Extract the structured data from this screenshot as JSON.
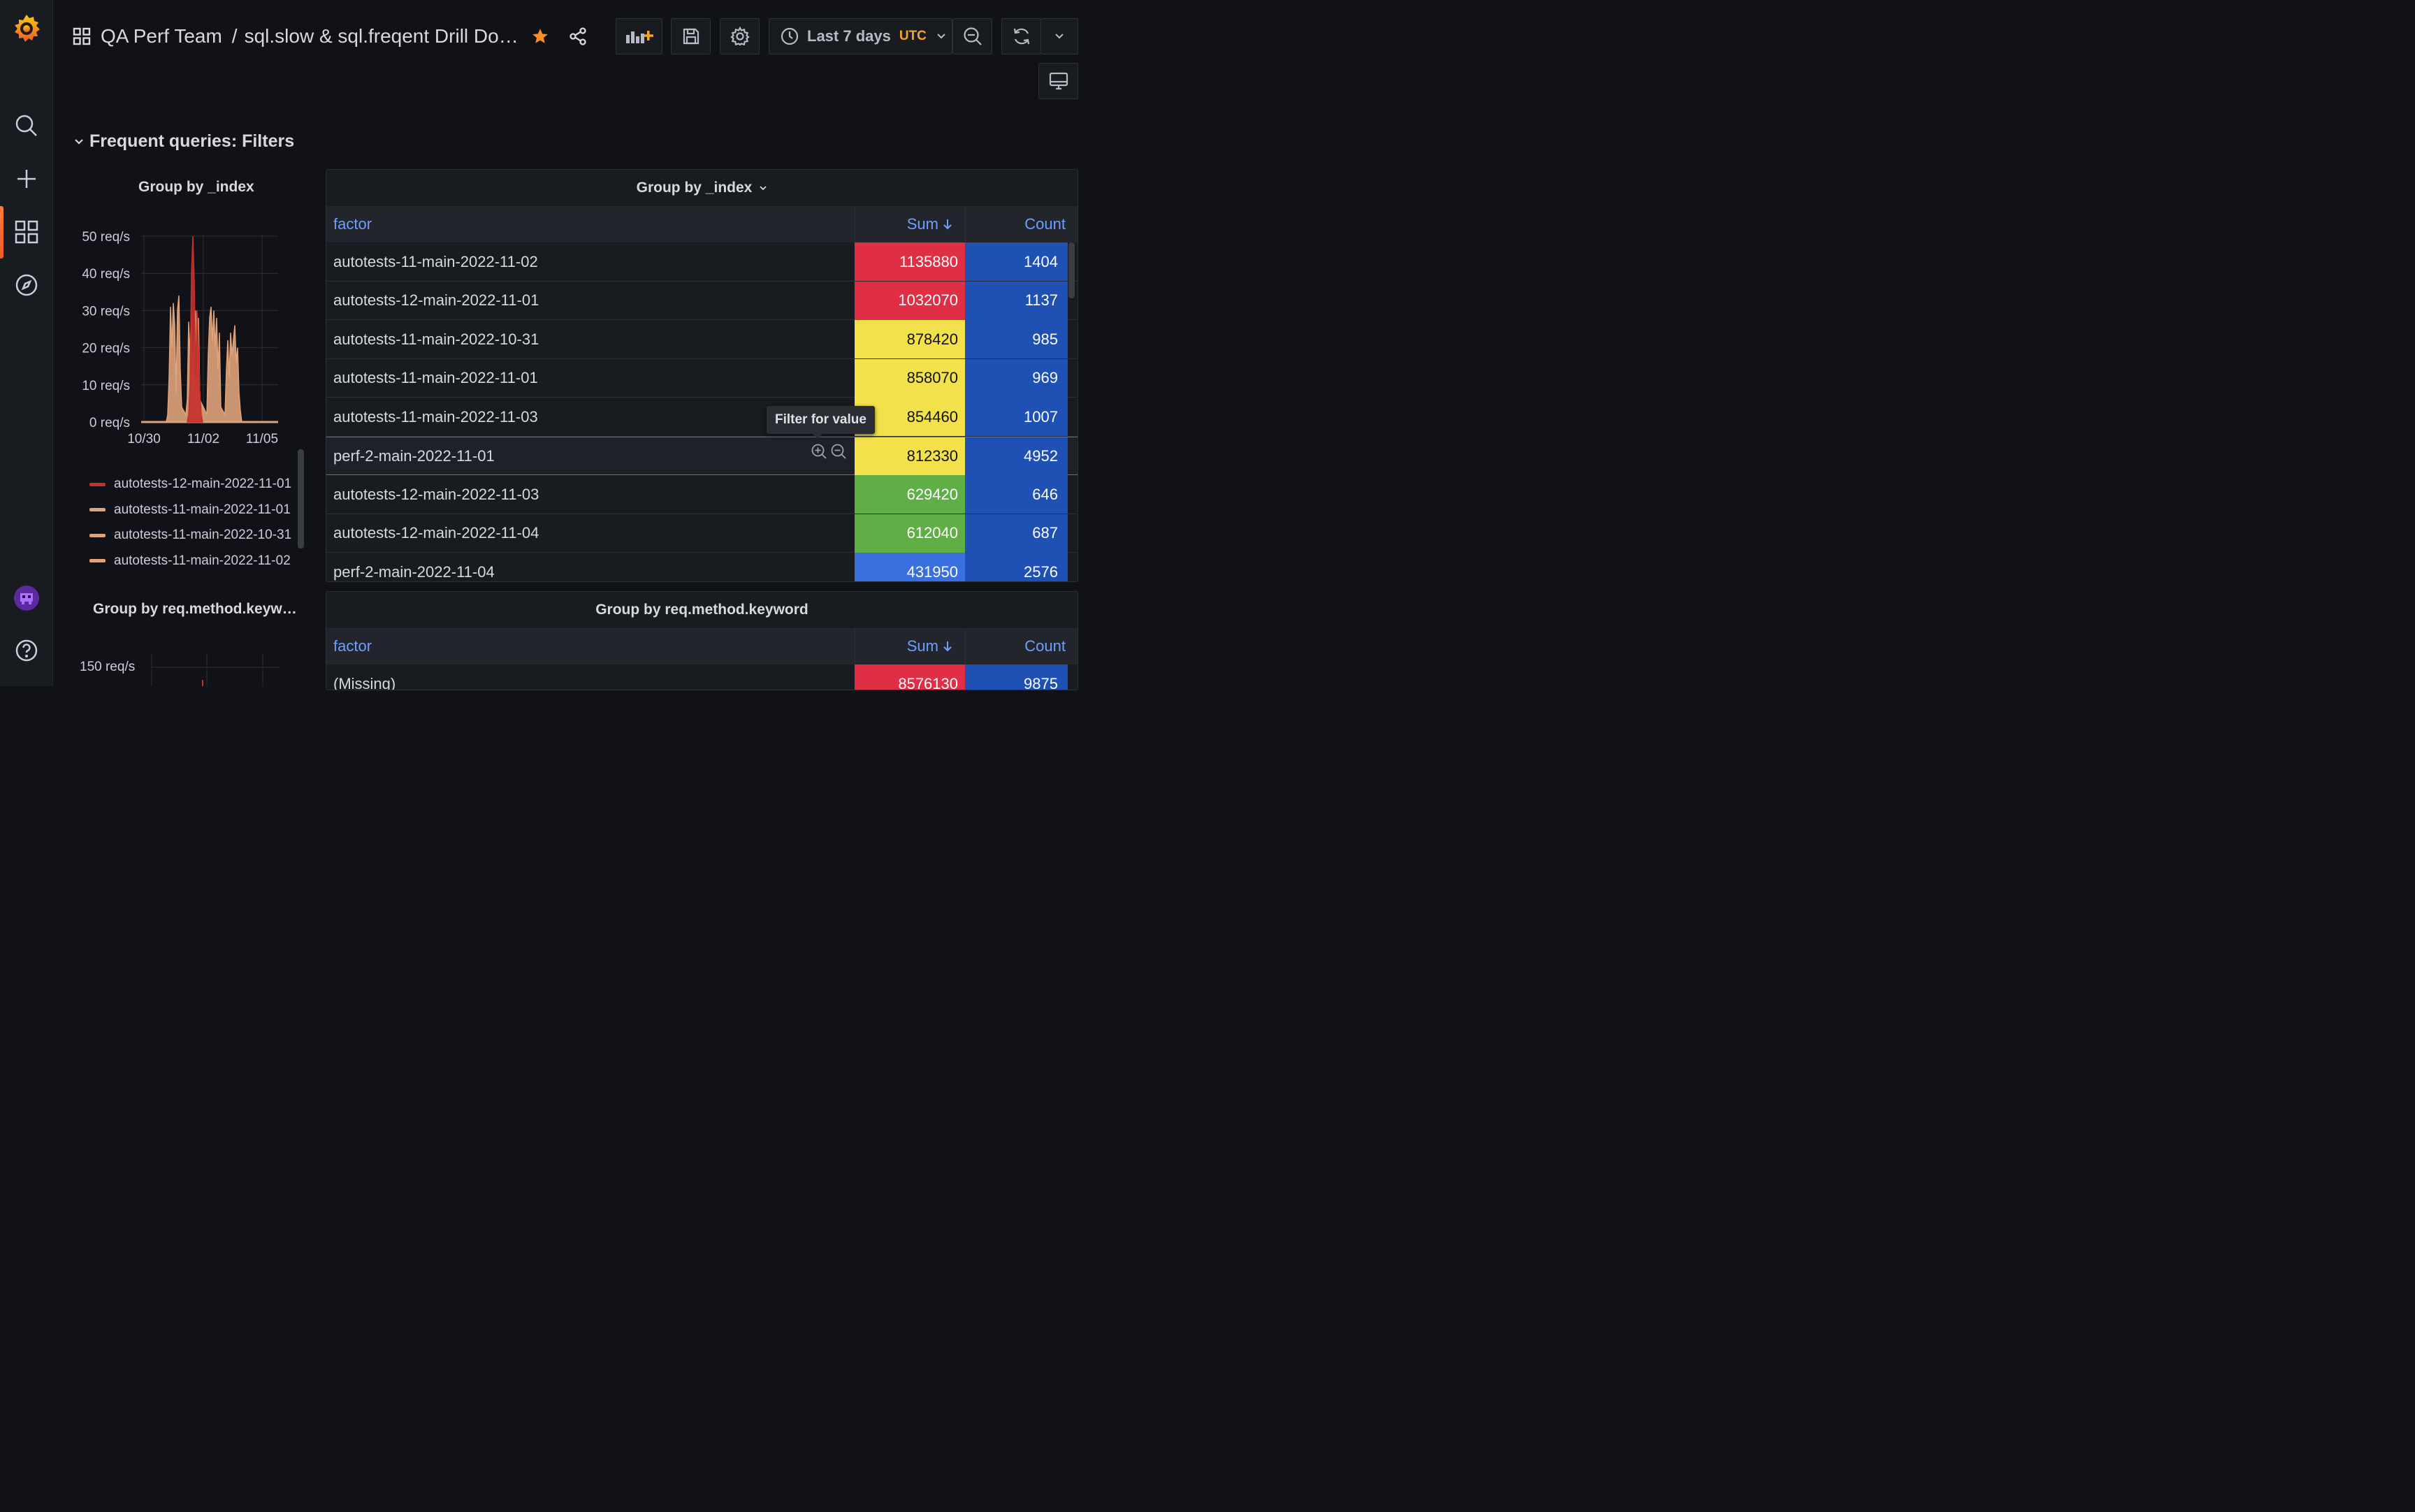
{
  "header": {
    "folder": "QA Perf Team",
    "separator": "/",
    "dashboard_title": "sql.slow & sql.freqent Drill Do…",
    "time_range": "Last 7 days",
    "timezone": "UTC"
  },
  "row": {
    "title": "Frequent queries: Filters"
  },
  "small_panel_1": {
    "title": "Group by _index",
    "chart_data": {
      "type": "area",
      "y_ticks": [
        "50 req/s",
        "40 req/s",
        "30 req/s",
        "20 req/s",
        "10 req/s",
        "0 req/s"
      ],
      "x_ticks": [
        "10/30",
        "11/02",
        "11/05"
      ],
      "ylim": [
        0,
        50
      ],
      "series": [
        {
          "name": "autotests-12-main-2022-11-01",
          "color": "#c4302b"
        },
        {
          "name": "autotests-11-main-2022-11-01",
          "color": "#e0a37a"
        },
        {
          "name": "autotests-11-main-2022-10-31",
          "color": "#e0a37a"
        },
        {
          "name": "autotests-11-main-2022-11-02",
          "color": "#e0a37a"
        }
      ]
    }
  },
  "small_panel_2": {
    "title": "Group by req.method.keyw…",
    "y_tick_top": "150 req/s"
  },
  "table_1": {
    "title": "Group by _index",
    "columns": [
      "factor",
      "Sum",
      "Count"
    ],
    "rows": [
      {
        "factor": "autotests-11-main-2022-11-02",
        "sum": "1135880",
        "count": "1404",
        "color": "#e02f44"
      },
      {
        "factor": "autotests-12-main-2022-11-01",
        "sum": "1032070",
        "count": "1137",
        "color": "#e02f44"
      },
      {
        "factor": "autotests-11-main-2022-10-31",
        "sum": "878420",
        "count": "985",
        "color": "#f2e14b"
      },
      {
        "factor": "autotests-11-main-2022-11-01",
        "sum": "858070",
        "count": "969",
        "color": "#f2e14b"
      },
      {
        "factor": "autotests-11-main-2022-11-03",
        "sum": "854460",
        "count": "1007",
        "color": "#f2e14b"
      },
      {
        "factor": "perf-2-main-2022-11-01",
        "sum": "812330",
        "count": "4952",
        "color": "#f2e14b"
      },
      {
        "factor": "autotests-12-main-2022-11-03",
        "sum": "629420",
        "count": "646",
        "color": "#5fae46"
      },
      {
        "factor": "autotests-12-main-2022-11-04",
        "sum": "612040",
        "count": "687",
        "color": "#5fae46"
      },
      {
        "factor": "perf-2-main-2022-11-04",
        "sum": "431950",
        "count": "2576",
        "color": "#3a6fe0"
      }
    ],
    "tooltip": "Filter for value"
  },
  "table_2": {
    "title": "Group by req.method.keyword",
    "columns": [
      "factor",
      "Sum",
      "Count"
    ],
    "rows": [
      {
        "factor": "(Missing)",
        "sum": "8576130",
        "count": "9875",
        "color": "#e02f44"
      }
    ]
  }
}
